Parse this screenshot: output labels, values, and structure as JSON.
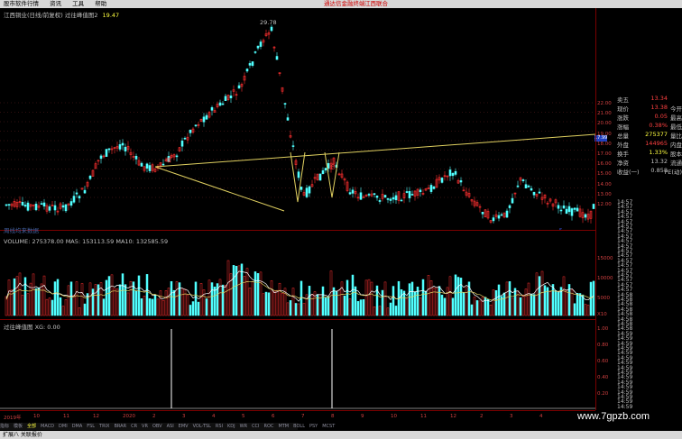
{
  "menu": {
    "items": [
      "股市软件行情",
      "资讯",
      "工具",
      "帮助"
    ],
    "promo_left": "通达信金融终端",
    "promo_right": "江西联合"
  },
  "main_chart": {
    "title": "江西铜业(日线/前复权) 过往峰值图2",
    "title_value": "19.47",
    "peak_label": "29.78",
    "bottom_label": "周线均来数据",
    "price_tag": "17.99",
    "axis_labels": [
      "22.00",
      "21.00",
      "20.00",
      "19.00",
      "18.00",
      "17.00",
      "16.00",
      "15.00",
      "14.00",
      "13.00",
      "12.00"
    ],
    "marker_labels": [
      "增",
      "仓"
    ],
    "small_tag": "S"
  },
  "volume_chart": {
    "title": "VOLUME: 275378.00  MA5: 153113.59  MA10: 132585.59",
    "axis_labels": [
      "15000",
      "10000",
      "5000"
    ],
    "unit_label": "X10"
  },
  "indicator_chart": {
    "title": "过往峰值图  XG: 0.00",
    "axis_labels": [
      "1.00",
      "0.80",
      "0.60",
      "0.40",
      "0.20"
    ]
  },
  "quote": {
    "rows": [
      {
        "k": "卖五",
        "v": "13.34",
        "x": ""
      },
      {
        "k": "现价",
        "v": "13.38",
        "x": "今开"
      },
      {
        "k": "涨跌",
        "v": "0.05",
        "x": "最高"
      },
      {
        "k": "涨幅",
        "v": "0.38%",
        "x": "最低"
      },
      {
        "k": "总量",
        "v": "275377",
        "x": "量比"
      },
      {
        "k": "外盘",
        "v": "144965",
        "x": "内盘"
      },
      {
        "k": "换手",
        "v": "1.33%",
        "x": "股本"
      },
      {
        "k": "净资",
        "v": "13.32",
        "x": "流通"
      },
      {
        "k": "收益(一)",
        "v": "0.858",
        "x": "PE(动)"
      }
    ],
    "colors": {
      "up": "#ff4040",
      "down": "#40ff40",
      "vol": "#ffff40"
    }
  },
  "ticks": {
    "times": [
      "14:57",
      "14:57",
      "14:57",
      "14:57",
      "14:57",
      "14:57",
      "14:57",
      "14:57",
      "14:57",
      "14:57",
      "14:57",
      "14:57",
      "14:57",
      "14:57",
      "14:57",
      "14:57",
      "14:57",
      "14:57",
      "14:57",
      "14:58",
      "14:58",
      "14:58",
      "14:58",
      "14:58",
      "14:58",
      "14:58",
      "14:58",
      "14:59",
      "14:59",
      "14:59",
      "14:59",
      "14:59",
      "14:59",
      "14:59",
      "14:59",
      "14:59",
      "14:59",
      "14:59",
      "14:59",
      "14:59",
      "14:59",
      "14:59",
      "14:59"
    ]
  },
  "date_axis": [
    "2019年",
    "10",
    "11",
    "12",
    "2020",
    "2",
    "3",
    "4",
    "5",
    "6",
    "7",
    "8",
    "9",
    "10",
    "11",
    "12",
    "2",
    "3",
    "4"
  ],
  "tabs": [
    "指标",
    "模板",
    "全部",
    "MACD",
    "DMI",
    "DMA",
    "FSL",
    "TRIX",
    "BRAR",
    "CR",
    "VR",
    "OBV",
    "ASI",
    "EMV",
    "VOL-TSL",
    "RSI",
    "KDJ",
    "WR",
    "CCI",
    "ROC",
    "MTM",
    "BOLL",
    "PSY",
    "MCST"
  ],
  "status": "扩展八  关联报价",
  "watermark": "www.7gpzb.com"
}
